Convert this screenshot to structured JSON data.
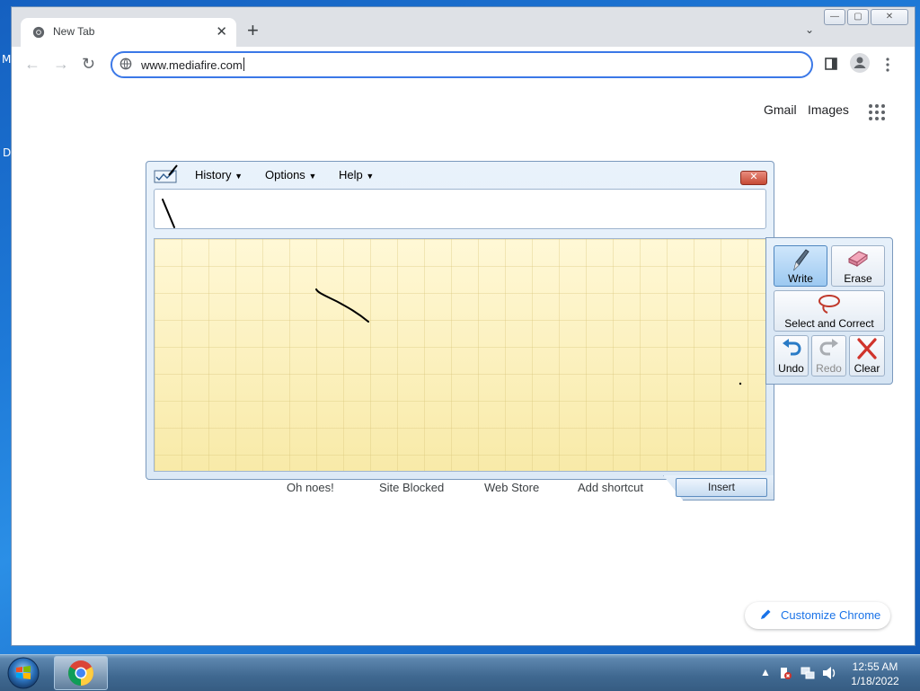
{
  "desktop": {
    "edge_letter_1": "M",
    "edge_letter_2": "D"
  },
  "browser": {
    "tab_title": "New Tab",
    "tab_close": "✕",
    "new_tab": "+",
    "tab_search": "⌄",
    "window_controls": {
      "minimize": "—",
      "maximize": "▢",
      "close": "✕"
    },
    "omnibox_value": "www.mediafire.com",
    "links": {
      "gmail": "Gmail",
      "images": "Images"
    },
    "shortcuts": [
      "Oh noes!",
      "Site Blocked",
      "Web Store",
      "Add shortcut"
    ],
    "customize_label": "Customize Chrome",
    "accent": "#1a73e8"
  },
  "tip": {
    "menus": {
      "history": "History",
      "options": "Options",
      "help": "Help"
    },
    "close": "✕",
    "tools": {
      "write": "Write",
      "erase": "Erase",
      "select_correct": "Select and Correct",
      "undo": "Undo",
      "redo": "Redo",
      "clear": "Clear"
    },
    "insert": "Insert"
  },
  "taskbar": {
    "time": "12:55 AM",
    "date": "1/18/2022"
  }
}
